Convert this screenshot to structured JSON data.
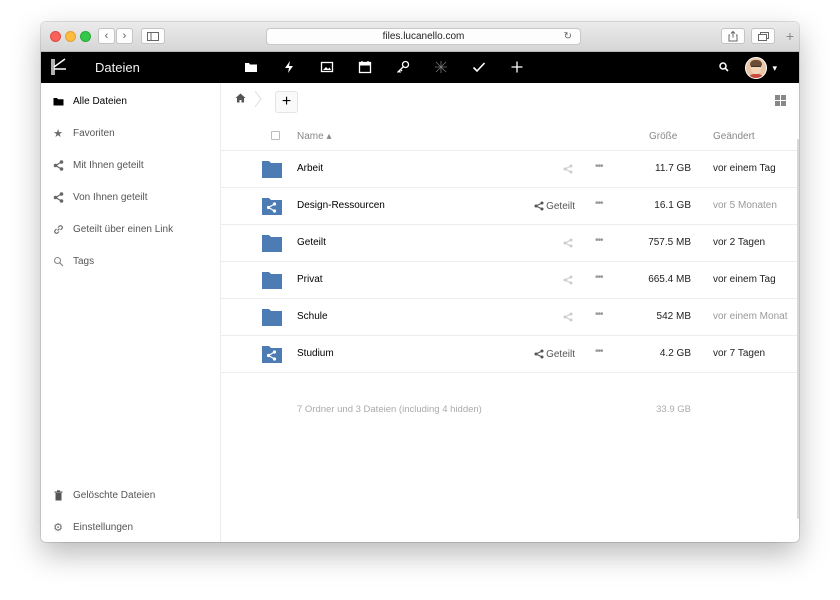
{
  "browser": {
    "url": "files.lucanello.com",
    "back_glyph": "‹",
    "forward_glyph": "›"
  },
  "header": {
    "app_title": "Dateien",
    "apps": [
      "folder-icon",
      "activity-icon",
      "gallery-icon",
      "calendar-icon",
      "passwords-icon",
      "deck-icon",
      "tasks-icon",
      "plus-icon"
    ]
  },
  "sidebar": {
    "items": [
      {
        "label": "Alle Dateien",
        "icon": "folder-icon",
        "active": true
      },
      {
        "label": "Favoriten",
        "icon": "star-icon"
      },
      {
        "label": "Mit Ihnen geteilt",
        "icon": "share-icon"
      },
      {
        "label": "Von Ihnen geteilt",
        "icon": "share-icon"
      },
      {
        "label": "Geteilt über einen Link",
        "icon": "link-icon"
      },
      {
        "label": "Tags",
        "icon": "tag-icon"
      }
    ],
    "bottom": [
      {
        "label": "Gelöschte Dateien",
        "icon": "trash-icon"
      },
      {
        "label": "Einstellungen",
        "icon": "gear-icon"
      }
    ]
  },
  "toolbar": {
    "new_label": "+"
  },
  "table": {
    "headers": {
      "name": "Name ▴",
      "size": "Größe",
      "modified": "Geändert"
    },
    "rows": [
      {
        "name": "Arbeit",
        "shared": false,
        "share_label": "",
        "size": "11.7 GB",
        "modified": "vor einem Tag",
        "old": false
      },
      {
        "name": "Design-Ressourcen",
        "shared": true,
        "share_label": "Geteilt",
        "size": "16.1 GB",
        "modified": "vor 5 Monaten",
        "old": true
      },
      {
        "name": "Geteilt",
        "shared": false,
        "share_label": "",
        "size": "757.5 MB",
        "modified": "vor 2 Tagen",
        "old": false
      },
      {
        "name": "Privat",
        "shared": false,
        "share_label": "",
        "size": "665.4 MB",
        "modified": "vor einem Tag",
        "old": false
      },
      {
        "name": "Schule",
        "shared": false,
        "share_label": "",
        "size": "542 MB",
        "modified": "vor einem Monat",
        "old": true
      },
      {
        "name": "Studium",
        "shared": true,
        "share_label": "Geteilt",
        "size": "4.2 GB",
        "modified": "vor 7 Tagen",
        "old": false
      }
    ],
    "more_glyph": "•••",
    "summary": "7 Ordner und 3 Dateien (including 4 hidden)",
    "total_size": "33.9 GB"
  },
  "colors": {
    "folder": "#4d7bb4",
    "header_bg": "#000000"
  }
}
